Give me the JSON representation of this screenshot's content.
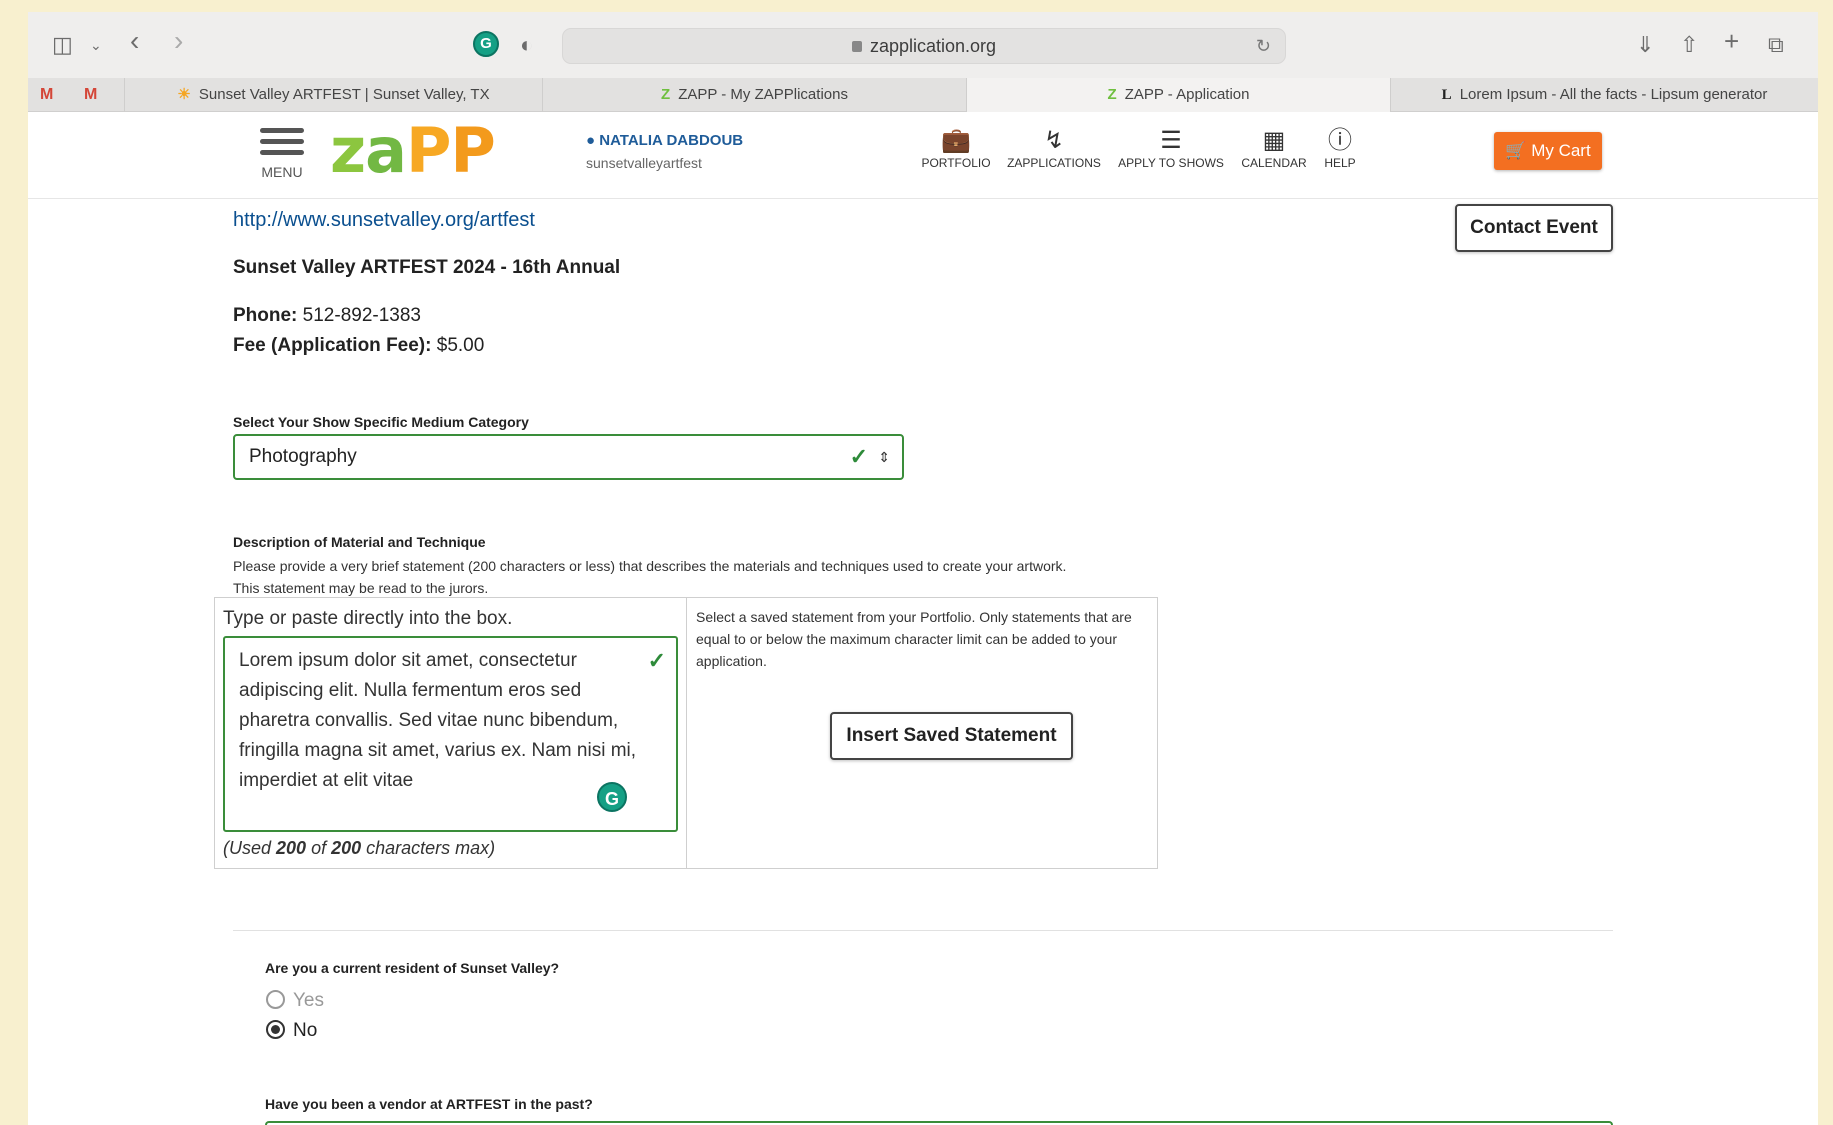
{
  "browser": {
    "url": "zapplication.org",
    "tabs": [
      {
        "label": "Sunset Valley ARTFEST | Sunset Valley, TX",
        "icon": "sun-favicon"
      },
      {
        "label": "ZAPP - My ZAPPlications",
        "icon": "zapp-favicon"
      },
      {
        "label": "ZAPP - Application",
        "icon": "zapp-favicon",
        "active": true
      },
      {
        "label": "Lorem Ipsum - All the facts - Lipsum generator",
        "icon": "lipsum-favicon"
      }
    ],
    "pinned": [
      "M",
      "M"
    ]
  },
  "header": {
    "menu_label": "MENU",
    "logo": "zaPP",
    "user_name": "NATALIA DABDOUB",
    "user_sub": "sunsetvalleyartfest",
    "nav": [
      "PORTFOLIO",
      "ZAPPLICATIONS",
      "APPLY TO SHOWS",
      "CALENDAR",
      "HELP"
    ],
    "cart_label": "My Cart",
    "accent_color": "#f36f21"
  },
  "event": {
    "link": "http://www.sunsetvalley.org/artfest",
    "contact_label": "Contact Event",
    "title": "Sunset Valley ARTFEST 2024 - 16th Annual",
    "phone_label": "Phone:",
    "phone": "512-892-1383",
    "fee_label": "Fee (Application Fee):",
    "fee": "$5.00"
  },
  "form": {
    "category_label": "Select Your Show Specific Medium Category",
    "category_value": "Photography",
    "desc_label": "Description of Material and Technique",
    "desc_help_1": "Please provide a very brief statement (200 characters or less) that describes the materials and techniques used to create your artwork.",
    "desc_help_2": "This statement may be read to the jurors.",
    "type_hint": "Type or paste directly into the box.",
    "statement": "Lorem ipsum dolor sit amet, consectetur adipiscing elit. Nulla fermentum eros sed pharetra convallis. Sed vitae nunc bibendum, fringilla magna sit amet, varius ex. Nam nisi mi, imperdiet at elit vitae",
    "used_prefix": "(Used ",
    "used_count": "200",
    "used_of": " of ",
    "used_max": "200",
    "used_suffix": " characters max)",
    "saved_help": "Select a saved statement from your Portfolio. Only statements that are equal to or below the maximum character limit can be added to your application.",
    "insert_label": "Insert Saved Statement",
    "q_resident": "Are you a current resident of Sunset Valley?",
    "opt_yes": "Yes",
    "opt_no": "No",
    "resident_selected": "No",
    "q_vendor": "Have you been a vendor at ARTFEST in the past?"
  }
}
